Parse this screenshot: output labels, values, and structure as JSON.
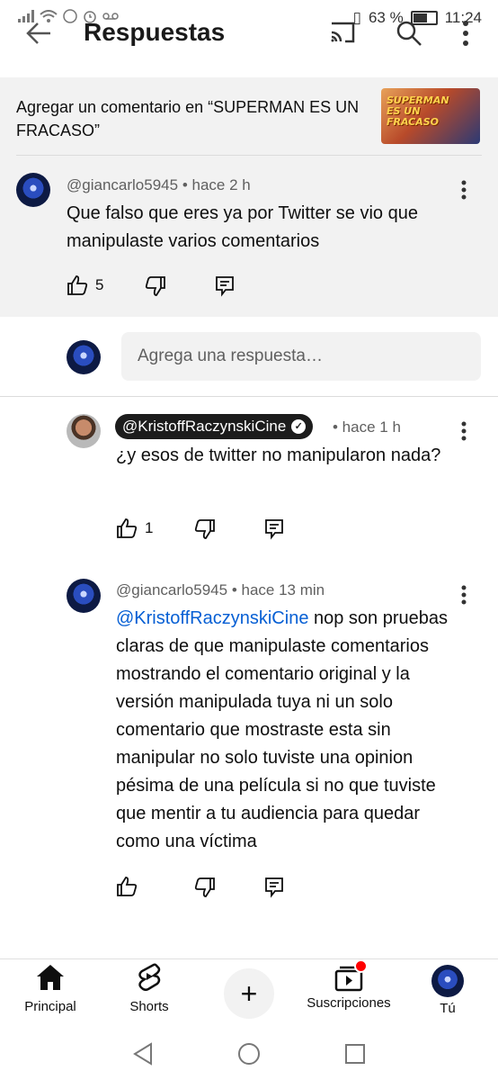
{
  "status_bar": {
    "left_icons": [
      "signal-icon",
      "wifi-icon",
      "data-icon",
      "alarm-icon",
      "voicemail-icon"
    ],
    "battery_percent": "63 %",
    "battery_level": 0.63,
    "time": "11:24"
  },
  "header": {
    "title": "Respuestas",
    "icons": [
      "back-icon",
      "cast-icon",
      "search-icon",
      "more-icon"
    ]
  },
  "context": {
    "text": "Agregar un comentario en “SUPERMAN ES UN FRACASO”",
    "thumbnail_text": "SUPERMAN ES UN FRACASO"
  },
  "parent_comment": {
    "author": "@giancarlo5945",
    "time": "• hace 2 h",
    "text": "Que falso que eres ya por Twitter se vio que manipulaste varios comentarios",
    "likes": "5"
  },
  "reply_input": {
    "placeholder": "Agrega una respuesta…"
  },
  "replies": [
    {
      "author": "@KristoffRaczynskiCine",
      "time": "• hace 1 h",
      "text": "¿y esos de twitter no manipularon nada?",
      "likes": "1"
    },
    {
      "author": "@giancarlo5945",
      "time": "• hace 13 min",
      "mention": "@KristoffRaczynskiCine",
      "text": " nop son pruebas claras de que manipulaste comentarios mostrando el comentario original y la versión manipulada tuya ni un solo comentario que mostraste esta sin manipular no solo tuviste una opinion pésima de una película si no que tuviste que mentir a tu audiencia para quedar como una víctima",
      "likes": ""
    }
  ],
  "bottom_nav": {
    "principal": "Principal",
    "shorts": "Shorts",
    "suscripciones": "Suscripciones",
    "tu": "Tú"
  },
  "colors": {
    "accent_link": "#065fd4",
    "notification_dot": "#ff0000",
    "panel_bg": "#f2f2f2"
  }
}
